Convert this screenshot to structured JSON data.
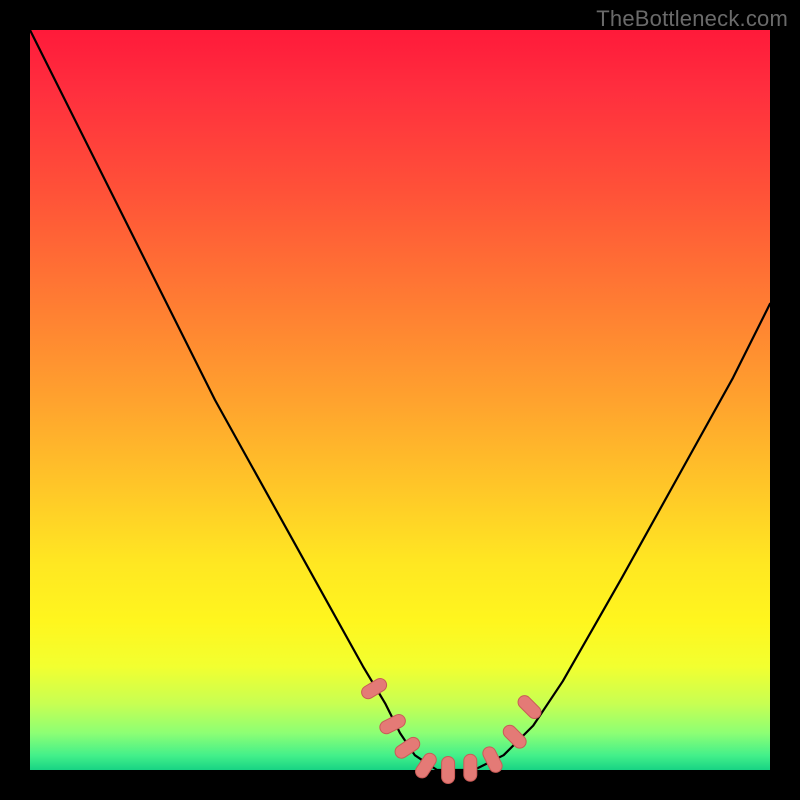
{
  "watermark": {
    "text": "TheBottleneck.com"
  },
  "colors": {
    "curve_stroke": "#000000",
    "marker_fill": "#e47a76",
    "marker_stroke": "#c95b57",
    "gradient_top": "#ff1a3a",
    "gradient_bottom": "#17d384",
    "frame": "#000000"
  },
  "chart_data": {
    "type": "line",
    "title": "",
    "xlabel": "",
    "ylabel": "",
    "xlim": [
      0,
      100
    ],
    "ylim": [
      0,
      100
    ],
    "grid": false,
    "legend_position": "none",
    "annotations": [
      "TheBottleneck.com"
    ],
    "series": [
      {
        "name": "bottleneck-curve",
        "x": [
          0,
          5,
          10,
          15,
          20,
          25,
          30,
          35,
          40,
          45,
          48,
          50,
          52,
          55,
          57,
          60,
          64,
          68,
          72,
          76,
          80,
          85,
          90,
          95,
          100
        ],
        "values": [
          100,
          90,
          80,
          70,
          60,
          50,
          41,
          32,
          23,
          14,
          9,
          5,
          2,
          0,
          0,
          0,
          2,
          6,
          12,
          19,
          26,
          35,
          44,
          53,
          63
        ]
      }
    ],
    "markers": [
      {
        "x": 46.5,
        "y": 11.0
      },
      {
        "x": 49.0,
        "y": 6.2
      },
      {
        "x": 51.0,
        "y": 3.0
      },
      {
        "x": 53.5,
        "y": 0.6
      },
      {
        "x": 56.5,
        "y": 0.0
      },
      {
        "x": 59.5,
        "y": 0.3
      },
      {
        "x": 62.5,
        "y": 1.4
      },
      {
        "x": 65.5,
        "y": 4.5
      },
      {
        "x": 67.5,
        "y": 8.5
      }
    ],
    "background_gradient": {
      "direction": "top-to-bottom",
      "stops": [
        {
          "pos": 0.0,
          "color": "#ff1a3a"
        },
        {
          "pos": 0.5,
          "color": "#ffa22e"
        },
        {
          "pos": 0.8,
          "color": "#fff61e"
        },
        {
          "pos": 1.0,
          "color": "#17d384"
        }
      ]
    }
  }
}
